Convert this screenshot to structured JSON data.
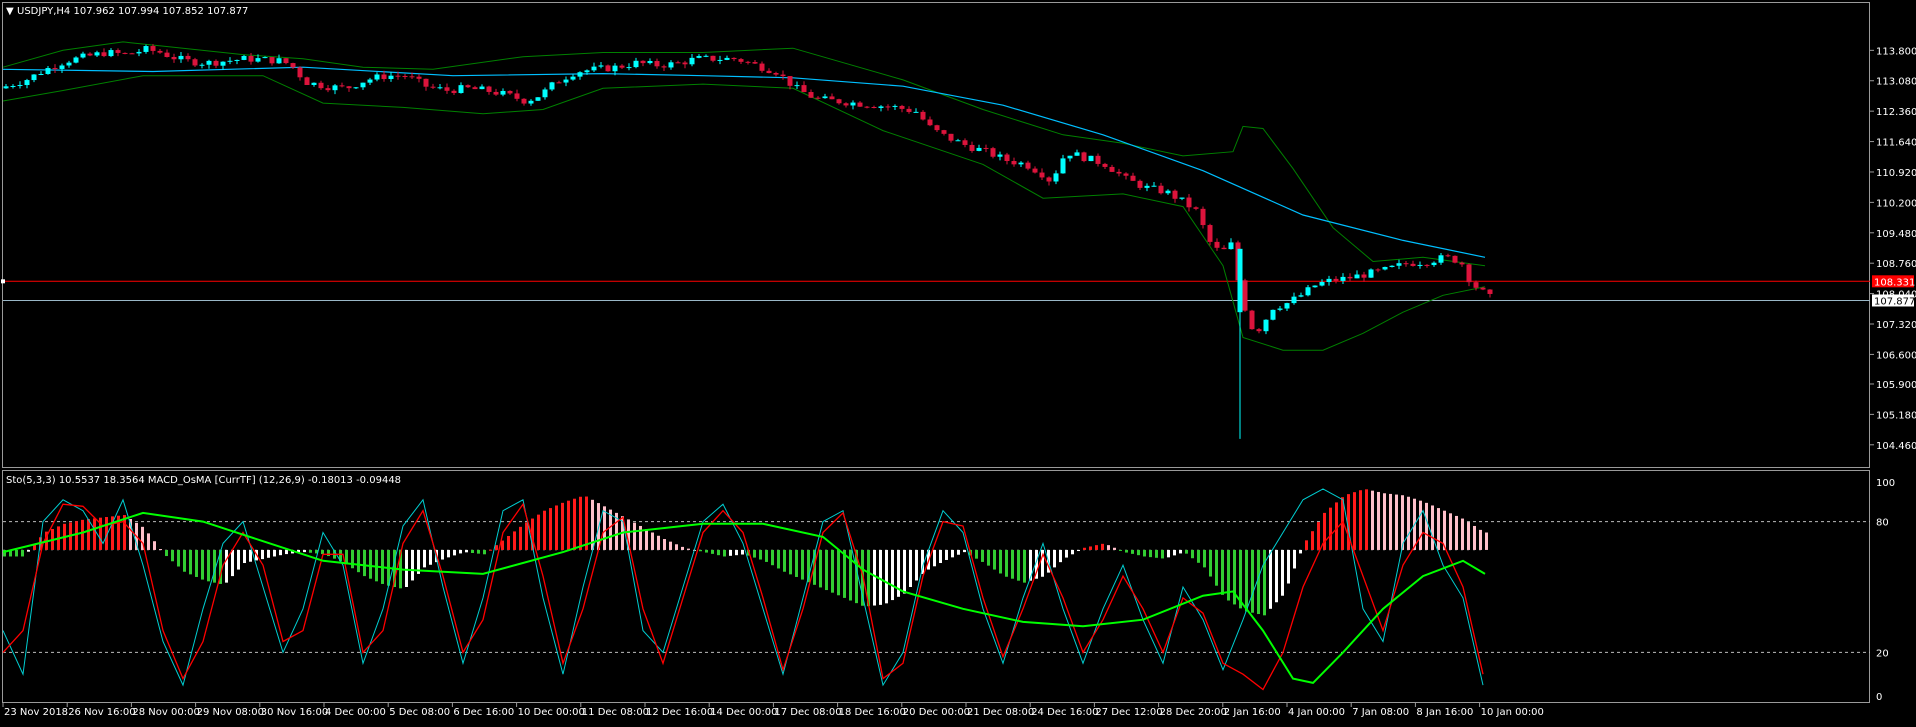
{
  "main_chart": {
    "header": "USDJPY,H4  107.962 107.994 107.852 107.877",
    "price_min": 104.1,
    "price_max": 114.4,
    "y_ticks": [
      "113.800",
      "113.080",
      "112.360",
      "111.640",
      "110.920",
      "110.200",
      "109.480",
      "108.760",
      "108.040",
      "107.320",
      "106.600",
      "105.900",
      "105.180",
      "104.460"
    ],
    "current_price": "107.877",
    "current_price_value": 107.877,
    "alert_price": "108.331",
    "alert_price_value": 108.331,
    "colors": {
      "bull": "#00ffff",
      "bear": "#dc143c",
      "bollinger": "#008000",
      "ma": "#00bfff",
      "alert_line": "#ff0000",
      "current_line": "#9ab7c7"
    }
  },
  "sub_chart": {
    "header": "Sto(5,3,3) 10.5537 18.3564  MACD_OsMA [CurrTF] (12,26,9) -0.18013 -0.09448",
    "y_ticks": [
      "100",
      "80",
      "20",
      "0"
    ],
    "levels": [
      80,
      20
    ],
    "colors": {
      "stoch_main": "#00ced1",
      "stoch_signal": "#ff0000",
      "macd_line": "#00ff00",
      "hist_pos_up": "#ff1a1a",
      "hist_pos_down": "#ffc0cb",
      "hist_neg_down": "#32cd32",
      "hist_neg_up": "#ffffff"
    }
  },
  "time_axis": [
    "23 Nov 2018",
    "26 Nov 16:00",
    "28 Nov 00:00",
    "29 Nov 08:00",
    "30 Nov 16:00",
    "4 Dec 00:00",
    "5 Dec 08:00",
    "6 Dec 16:00",
    "10 Dec 00:00",
    "11 Dec 08:00",
    "12 Dec 16:00",
    "14 Dec 00:00",
    "17 Dec 08:00",
    "18 Dec 16:00",
    "20 Dec 00:00",
    "21 Dec 08:00",
    "24 Dec 16:00",
    "27 Dec 12:00",
    "28 Dec 20:00",
    "2 Jan 16:00",
    "4 Jan 00:00",
    "7 Jan 08:00",
    "8 Jan 16:00",
    "10 Jan 00:00"
  ],
  "chart_data": {
    "type": "candlestick",
    "symbol": "USDJPY",
    "timeframe": "H4",
    "ohlc_last": {
      "open": 107.962,
      "high": 107.994,
      "low": 107.852,
      "close": 107.877
    },
    "close_path": [
      [
        0,
        112.95
      ],
      [
        20,
        113.1
      ],
      [
        40,
        113.35
      ],
      [
        60,
        113.55
      ],
      [
        80,
        113.65
      ],
      [
        100,
        113.75
      ],
      [
        120,
        113.7
      ],
      [
        140,
        113.82
      ],
      [
        155,
        113.75
      ],
      [
        165,
        113.65
      ],
      [
        180,
        113.55
      ],
      [
        200,
        113.5
      ],
      [
        220,
        113.55
      ],
      [
        240,
        113.6
      ],
      [
        260,
        113.58
      ],
      [
        275,
        113.55
      ],
      [
        285,
        113.45
      ],
      [
        300,
        113.05
      ],
      [
        320,
        112.95
      ],
      [
        340,
        112.9
      ],
      [
        360,
        113.1
      ],
      [
        380,
        113.2
      ],
      [
        400,
        113.2
      ],
      [
        420,
        112.95
      ],
      [
        440,
        112.85
      ],
      [
        460,
        112.9
      ],
      [
        480,
        112.85
      ],
      [
        500,
        112.75
      ],
      [
        520,
        112.6
      ],
      [
        535,
        112.75
      ],
      [
        550,
        113.05
      ],
      [
        570,
        113.3
      ],
      [
        590,
        113.35
      ],
      [
        610,
        113.4
      ],
      [
        630,
        113.5
      ],
      [
        650,
        113.45
      ],
      [
        670,
        113.48
      ],
      [
        690,
        113.6
      ],
      [
        710,
        113.6
      ],
      [
        730,
        113.6
      ],
      [
        750,
        113.45
      ],
      [
        770,
        113.3
      ],
      [
        790,
        112.9
      ],
      [
        810,
        112.65
      ],
      [
        830,
        112.6
      ],
      [
        850,
        112.55
      ],
      [
        870,
        112.5
      ],
      [
        890,
        112.45
      ],
      [
        910,
        112.35
      ],
      [
        925,
        111.95
      ],
      [
        940,
        111.75
      ],
      [
        960,
        111.55
      ],
      [
        980,
        111.4
      ],
      [
        1000,
        111.2
      ],
      [
        1020,
        111.1
      ],
      [
        1035,
        110.9
      ],
      [
        1045,
        110.7
      ],
      [
        1060,
        111.4
      ],
      [
        1080,
        111.25
      ],
      [
        1100,
        111.1
      ],
      [
        1120,
        110.75
      ],
      [
        1140,
        110.55
      ],
      [
        1160,
        110.45
      ],
      [
        1175,
        110.25
      ],
      [
        1190,
        110.0
      ],
      [
        1205,
        109.2
      ],
      [
        1215,
        109.0
      ],
      [
        1225,
        109.2
      ],
      [
        1235,
        108.0
      ],
      [
        1245,
        107.25
      ],
      [
        1255,
        107.2
      ],
      [
        1265,
        107.7
      ],
      [
        1280,
        107.8
      ],
      [
        1295,
        108.0
      ],
      [
        1310,
        108.25
      ],
      [
        1325,
        108.35
      ],
      [
        1340,
        108.4
      ],
      [
        1360,
        108.5
      ],
      [
        1380,
        108.6
      ],
      [
        1400,
        108.75
      ],
      [
        1420,
        108.8
      ],
      [
        1440,
        108.9
      ],
      [
        1455,
        108.8
      ],
      [
        1465,
        108.3
      ],
      [
        1478,
        108.05
      ],
      [
        1488,
        107.877
      ]
    ],
    "spike": {
      "x": 1237,
      "high": 109.1,
      "low": 104.6
    },
    "ma_path": [
      [
        0,
        113.35
      ],
      [
        150,
        113.3
      ],
      [
        300,
        113.4
      ],
      [
        450,
        113.2
      ],
      [
        600,
        113.25
      ],
      [
        700,
        113.2
      ],
      [
        790,
        113.15
      ],
      [
        900,
        112.95
      ],
      [
        1000,
        112.5
      ],
      [
        1100,
        111.8
      ],
      [
        1200,
        110.95
      ],
      [
        1300,
        109.9
      ],
      [
        1400,
        109.3
      ],
      [
        1482,
        108.9
      ]
    ],
    "bb_upper": [
      [
        0,
        113.4
      ],
      [
        60,
        113.8
      ],
      [
        120,
        114.0
      ],
      [
        160,
        113.9
      ],
      [
        240,
        113.7
      ],
      [
        300,
        113.6
      ],
      [
        360,
        113.4
      ],
      [
        430,
        113.35
      ],
      [
        520,
        113.65
      ],
      [
        600,
        113.75
      ],
      [
        700,
        113.75
      ],
      [
        790,
        113.85
      ],
      [
        900,
        113.1
      ],
      [
        980,
        112.4
      ],
      [
        1060,
        111.8
      ],
      [
        1120,
        111.6
      ],
      [
        1180,
        111.3
      ],
      [
        1230,
        111.4
      ],
      [
        1240,
        112.0
      ],
      [
        1260,
        111.95
      ],
      [
        1290,
        111.0
      ],
      [
        1330,
        109.6
      ],
      [
        1370,
        108.8
      ],
      [
        1420,
        108.9
      ],
      [
        1482,
        108.7
      ]
    ],
    "bb_lower": [
      [
        0,
        112.6
      ],
      [
        60,
        112.85
      ],
      [
        140,
        113.2
      ],
      [
        200,
        113.2
      ],
      [
        260,
        113.2
      ],
      [
        320,
        112.55
      ],
      [
        400,
        112.45
      ],
      [
        480,
        112.3
      ],
      [
        540,
        112.4
      ],
      [
        600,
        112.9
      ],
      [
        700,
        113.0
      ],
      [
        790,
        112.9
      ],
      [
        880,
        111.9
      ],
      [
        980,
        111.1
      ],
      [
        1040,
        110.3
      ],
      [
        1120,
        110.4
      ],
      [
        1180,
        110.1
      ],
      [
        1220,
        108.7
      ],
      [
        1240,
        107.0
      ],
      [
        1280,
        106.7
      ],
      [
        1320,
        106.7
      ],
      [
        1360,
        107.1
      ],
      [
        1400,
        107.6
      ],
      [
        1440,
        108.0
      ],
      [
        1482,
        108.2
      ]
    ],
    "stoch_main": [
      [
        0,
        30
      ],
      [
        20,
        10
      ],
      [
        40,
        80
      ],
      [
        60,
        90
      ],
      [
        80,
        85
      ],
      [
        100,
        70
      ],
      [
        120,
        90
      ],
      [
        140,
        60
      ],
      [
        160,
        25
      ],
      [
        180,
        5
      ],
      [
        200,
        40
      ],
      [
        220,
        70
      ],
      [
        240,
        80
      ],
      [
        260,
        50
      ],
      [
        280,
        20
      ],
      [
        300,
        40
      ],
      [
        320,
        75
      ],
      [
        340,
        60
      ],
      [
        360,
        15
      ],
      [
        380,
        40
      ],
      [
        400,
        78
      ],
      [
        420,
        90
      ],
      [
        440,
        50
      ],
      [
        460,
        15
      ],
      [
        480,
        45
      ],
      [
        500,
        85
      ],
      [
        520,
        90
      ],
      [
        540,
        45
      ],
      [
        560,
        10
      ],
      [
        580,
        50
      ],
      [
        600,
        85
      ],
      [
        620,
        80
      ],
      [
        640,
        30
      ],
      [
        660,
        20
      ],
      [
        680,
        50
      ],
      [
        700,
        80
      ],
      [
        720,
        88
      ],
      [
        740,
        70
      ],
      [
        760,
        40
      ],
      [
        780,
        10
      ],
      [
        800,
        45
      ],
      [
        820,
        80
      ],
      [
        840,
        85
      ],
      [
        860,
        45
      ],
      [
        880,
        5
      ],
      [
        900,
        20
      ],
      [
        920,
        60
      ],
      [
        940,
        85
      ],
      [
        960,
        75
      ],
      [
        980,
        40
      ],
      [
        1000,
        15
      ],
      [
        1020,
        45
      ],
      [
        1040,
        70
      ],
      [
        1060,
        40
      ],
      [
        1080,
        15
      ],
      [
        1100,
        40
      ],
      [
        1120,
        60
      ],
      [
        1140,
        35
      ],
      [
        1160,
        15
      ],
      [
        1180,
        50
      ],
      [
        1200,
        35
      ],
      [
        1220,
        12
      ],
      [
        1240,
        35
      ],
      [
        1260,
        60
      ],
      [
        1280,
        75
      ],
      [
        1300,
        90
      ],
      [
        1320,
        95
      ],
      [
        1340,
        90
      ],
      [
        1360,
        40
      ],
      [
        1380,
        25
      ],
      [
        1400,
        70
      ],
      [
        1420,
        85
      ],
      [
        1440,
        60
      ],
      [
        1460,
        45
      ],
      [
        1480,
        5
      ]
    ],
    "stoch_signal": [
      [
        0,
        20
      ],
      [
        20,
        30
      ],
      [
        40,
        70
      ],
      [
        60,
        88
      ],
      [
        80,
        87
      ],
      [
        100,
        78
      ],
      [
        120,
        80
      ],
      [
        140,
        70
      ],
      [
        160,
        30
      ],
      [
        180,
        8
      ],
      [
        200,
        25
      ],
      [
        220,
        60
      ],
      [
        240,
        75
      ],
      [
        260,
        60
      ],
      [
        280,
        25
      ],
      [
        300,
        30
      ],
      [
        320,
        65
      ],
      [
        340,
        65
      ],
      [
        360,
        20
      ],
      [
        380,
        30
      ],
      [
        400,
        70
      ],
      [
        420,
        85
      ],
      [
        440,
        55
      ],
      [
        460,
        20
      ],
      [
        480,
        35
      ],
      [
        500,
        75
      ],
      [
        520,
        88
      ],
      [
        540,
        55
      ],
      [
        560,
        15
      ],
      [
        580,
        40
      ],
      [
        600,
        75
      ],
      [
        620,
        82
      ],
      [
        640,
        40
      ],
      [
        660,
        15
      ],
      [
        680,
        45
      ],
      [
        700,
        75
      ],
      [
        720,
        85
      ],
      [
        740,
        75
      ],
      [
        760,
        45
      ],
      [
        780,
        12
      ],
      [
        800,
        40
      ],
      [
        820,
        75
      ],
      [
        840,
        84
      ],
      [
        860,
        55
      ],
      [
        880,
        8
      ],
      [
        900,
        15
      ],
      [
        920,
        55
      ],
      [
        940,
        80
      ],
      [
        960,
        78
      ],
      [
        980,
        45
      ],
      [
        1000,
        18
      ],
      [
        1020,
        40
      ],
      [
        1040,
        65
      ],
      [
        1060,
        45
      ],
      [
        1080,
        20
      ],
      [
        1100,
        35
      ],
      [
        1120,
        55
      ],
      [
        1140,
        40
      ],
      [
        1160,
        20
      ],
      [
        1180,
        45
      ],
      [
        1200,
        38
      ],
      [
        1220,
        15
      ],
      [
        1240,
        10
      ],
      [
        1260,
        3
      ],
      [
        1280,
        20
      ],
      [
        1300,
        50
      ],
      [
        1320,
        70
      ],
      [
        1340,
        80
      ],
      [
        1360,
        55
      ],
      [
        1380,
        30
      ],
      [
        1400,
        60
      ],
      [
        1420,
        75
      ],
      [
        1440,
        70
      ],
      [
        1460,
        50
      ],
      [
        1480,
        10
      ]
    ],
    "macd_line": [
      [
        0,
        66
      ],
      [
        80,
        75
      ],
      [
        140,
        84
      ],
      [
        200,
        80
      ],
      [
        260,
        71
      ],
      [
        320,
        62
      ],
      [
        400,
        58
      ],
      [
        480,
        56
      ],
      [
        560,
        66
      ],
      [
        620,
        75
      ],
      [
        700,
        79
      ],
      [
        760,
        79
      ],
      [
        820,
        73
      ],
      [
        860,
        58
      ],
      [
        900,
        48
      ],
      [
        960,
        40
      ],
      [
        1020,
        34
      ],
      [
        1080,
        32
      ],
      [
        1140,
        35
      ],
      [
        1200,
        46
      ],
      [
        1230,
        48
      ],
      [
        1260,
        30
      ],
      [
        1290,
        8
      ],
      [
        1310,
        6
      ],
      [
        1340,
        20
      ],
      [
        1380,
        40
      ],
      [
        1420,
        55
      ],
      [
        1460,
        62
      ],
      [
        1482,
        56
      ]
    ],
    "histogram_zero": 67,
    "histogram": [
      [
        20,
        -3
      ],
      [
        40,
        8
      ],
      [
        60,
        12
      ],
      [
        80,
        14
      ],
      [
        100,
        15
      ],
      [
        120,
        16
      ],
      [
        140,
        10
      ],
      [
        160,
        -2
      ],
      [
        180,
        -10
      ],
      [
        200,
        -14
      ],
      [
        220,
        -16
      ],
      [
        240,
        -6
      ],
      [
        260,
        -4
      ],
      [
        280,
        -2
      ],
      [
        300,
        -1
      ],
      [
        320,
        -2
      ],
      [
        340,
        -6
      ],
      [
        360,
        -12
      ],
      [
        380,
        -16
      ],
      [
        400,
        -18
      ],
      [
        420,
        -8
      ],
      [
        440,
        -4
      ],
      [
        460,
        -1
      ],
      [
        480,
        -2
      ],
      [
        500,
        5
      ],
      [
        520,
        12
      ],
      [
        540,
        18
      ],
      [
        560,
        22
      ],
      [
        580,
        25
      ],
      [
        600,
        20
      ],
      [
        620,
        15
      ],
      [
        640,
        10
      ],
      [
        660,
        5
      ],
      [
        680,
        1
      ],
      [
        700,
        -1
      ],
      [
        720,
        -3
      ],
      [
        740,
        -2
      ],
      [
        760,
        -5
      ],
      [
        780,
        -10
      ],
      [
        800,
        -14
      ],
      [
        820,
        -18
      ],
      [
        840,
        -22
      ],
      [
        860,
        -26
      ],
      [
        880,
        -25
      ],
      [
        900,
        -20
      ],
      [
        920,
        -10
      ],
      [
        940,
        -5
      ],
      [
        960,
        -1
      ],
      [
        980,
        -6
      ],
      [
        1000,
        -12
      ],
      [
        1020,
        -15
      ],
      [
        1040,
        -12
      ],
      [
        1060,
        -4
      ],
      [
        1080,
        1
      ],
      [
        1100,
        3
      ],
      [
        1120,
        -1
      ],
      [
        1140,
        -3
      ],
      [
        1160,
        -4
      ],
      [
        1180,
        -1
      ],
      [
        1200,
        -8
      ],
      [
        1220,
        -22
      ],
      [
        1240,
        -28
      ],
      [
        1260,
        -30
      ],
      [
        1280,
        -20
      ],
      [
        1300,
        3
      ],
      [
        1320,
        17
      ],
      [
        1340,
        25
      ],
      [
        1360,
        28
      ],
      [
        1380,
        26
      ],
      [
        1400,
        25
      ],
      [
        1420,
        22
      ],
      [
        1440,
        18
      ],
      [
        1460,
        14
      ],
      [
        1480,
        8
      ]
    ]
  }
}
